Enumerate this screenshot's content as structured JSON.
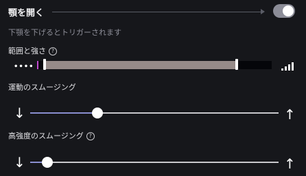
{
  "header": {
    "title": "顎を開く",
    "toggle_on": true
  },
  "subtitle": "下顎を下げるとトリガーされます",
  "range": {
    "label": "範囲と強さ",
    "help": "?",
    "low_icon": "dots-icon",
    "high_icon": "signal-bars-icon"
  },
  "motion_smoothing": {
    "label": "運動のスムージング",
    "value": 0.27,
    "down": "↓",
    "up": "↑"
  },
  "high_intensity_smoothing": {
    "label": "高強度のスムージング",
    "help": "?",
    "value": 0.07,
    "down": "↓",
    "up": "↑"
  },
  "colors": {
    "accent": "#8a8fd0",
    "range_fill": "#968b89",
    "range_low": "#c24ad0"
  }
}
